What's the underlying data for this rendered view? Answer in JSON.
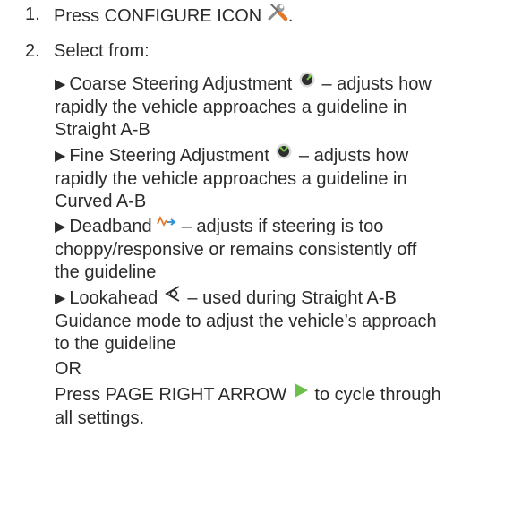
{
  "steps": [
    {
      "number": "1.",
      "text": "Press CONFIGURE ICON",
      "suffix": ".",
      "icon": "configure-tools-icon"
    },
    {
      "number": "2.",
      "text": "Select from:"
    }
  ],
  "options": [
    {
      "label": "Coarse Steering Adjustment",
      "icon": "coarse-steering-knob-icon",
      "description_line1": " – adjusts how",
      "description_rest": [
        "rapidly the vehicle approaches a guideline in",
        "Straight A-B"
      ]
    },
    {
      "label": "Fine Steering Adjustment",
      "icon": "fine-steering-knob-icon",
      "description_line1": " – adjusts how",
      "description_rest": [
        "rapidly the vehicle approaches a guideline in",
        "Curved A-B"
      ]
    },
    {
      "label": "Deadband",
      "icon": "deadband-icon",
      "description_line1": " – adjusts if steering is too",
      "description_rest": [
        "choppy/responsive or remains consistently off",
        "the guideline"
      ]
    },
    {
      "label": "Lookahead",
      "icon": "lookahead-icon",
      "description_line1": " – used during Straight A-B",
      "description_rest": [
        "Guidance mode to adjust the vehicle’s approach",
        "to the guideline"
      ]
    }
  ],
  "or_text": "OR",
  "final": {
    "text_before": "Press PAGE RIGHT ARROW",
    "icon": "page-right-arrow-icon",
    "text_after": " to cycle through",
    "text_rest": "all settings."
  },
  "colors": {
    "text": "#2b2b2b",
    "arrow_green": "#6cc04a",
    "tool_orange": "#e0792a"
  }
}
